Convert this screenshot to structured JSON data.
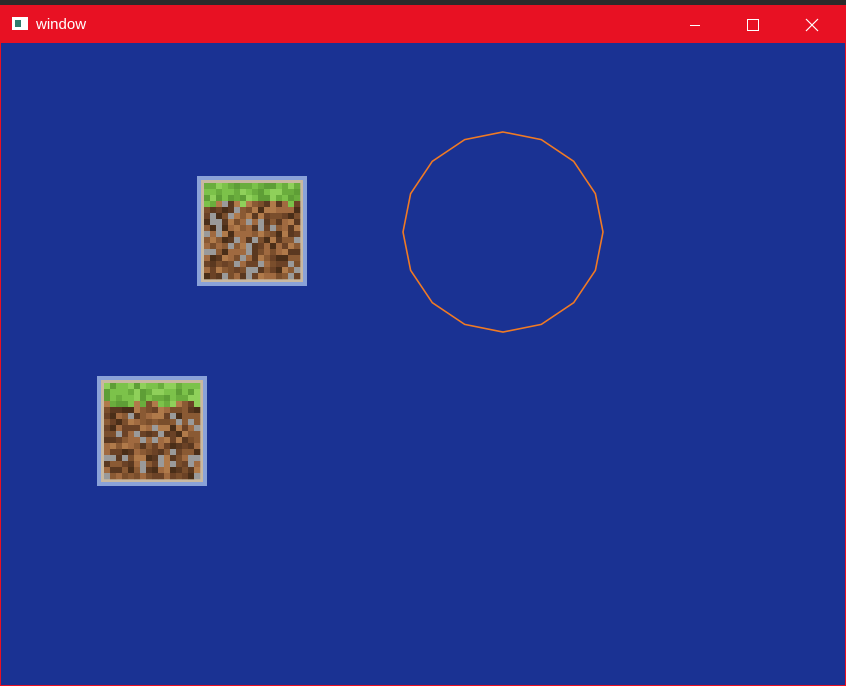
{
  "window": {
    "title": "window",
    "titlebar_color": "#e81123",
    "client_color": "#1a3293"
  },
  "icons": {
    "app": "window-app-icon",
    "minimize": "minimize-icon",
    "maximize": "maximize-icon",
    "close": "close-icon"
  },
  "scene": {
    "sprites": [
      {
        "name": "grass-dirt-block"
      },
      {
        "name": "grass-dirt-block"
      }
    ],
    "circle": {
      "stroke_color": "#f07a24",
      "segments": 16
    }
  }
}
